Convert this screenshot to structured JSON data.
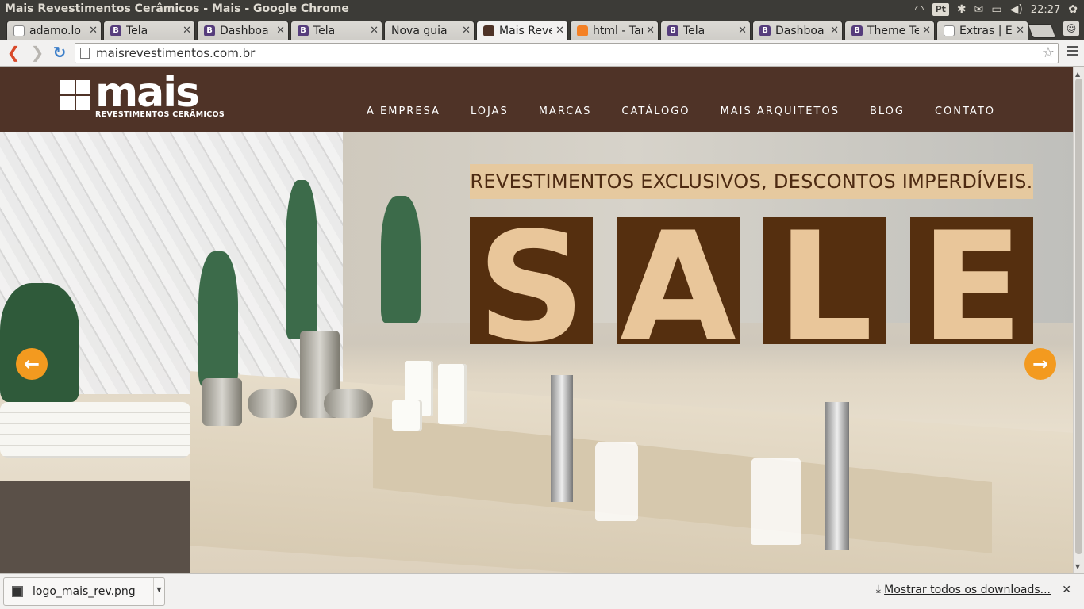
{
  "os": {
    "window_title": "Mais Revestimentos Cerâmicos - Mais - Google Chrome",
    "keyboard_layout": "Pt",
    "clock": "22:27",
    "tray_icons": [
      "wifi-icon",
      "bluetooth-icon",
      "mail-icon",
      "battery-icon",
      "volume-icon",
      "gear-icon"
    ]
  },
  "tabs": [
    {
      "label": "adamo.lo",
      "icon": "document-icon"
    },
    {
      "label": "Tela",
      "icon": "bootstrap-icon"
    },
    {
      "label": "Dashboa",
      "icon": "bootstrap-icon"
    },
    {
      "label": "Tela",
      "icon": "bootstrap-icon"
    },
    {
      "label": "Nova guia",
      "icon": "none"
    },
    {
      "label": "Mais Reve",
      "icon": "mais-icon",
      "active": true
    },
    {
      "label": "html - Tar",
      "icon": "stackoverflow-icon"
    },
    {
      "label": "Tela",
      "icon": "bootstrap-icon"
    },
    {
      "label": "Dashboa",
      "icon": "bootstrap-icon"
    },
    {
      "label": "Theme Te",
      "icon": "bootstrap-icon"
    },
    {
      "label": "Extras | E",
      "icon": "document-icon"
    }
  ],
  "toolbar": {
    "url": "maisrevestimentos.com.br"
  },
  "site": {
    "logo_text": "mais",
    "logo_subtitle": "REVESTIMENTOS CERÂMICOS",
    "nav": [
      "A EMPRESA",
      "LOJAS",
      "MARCAS",
      "CATÁLOGO",
      "MAIS ARQUITETOS",
      "BLOG",
      "CONTATO"
    ],
    "hero": {
      "banner": "REVESTIMENTOS EXCLUSIVOS, DESCONTOS IMPERDÍVEIS.",
      "sale_letters": [
        "S",
        "A",
        "L",
        "E"
      ],
      "accent_color": "#f39a1f",
      "sale_color": "#552f0f"
    },
    "brand_color": "#4f3327"
  },
  "downloads": {
    "file_name": "logo_mais_rev.png",
    "show_all": "Mostrar todos os downloads..."
  }
}
